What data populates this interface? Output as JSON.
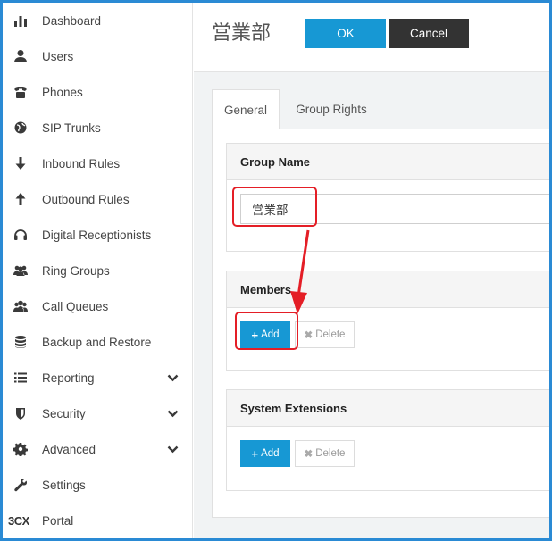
{
  "sidebar": {
    "items": [
      {
        "label": "Dashboard",
        "icon": "bar-chart-icon"
      },
      {
        "label": "Users",
        "icon": "user-icon"
      },
      {
        "label": "Phones",
        "icon": "phone-icon"
      },
      {
        "label": "SIP Trunks",
        "icon": "globe-icon"
      },
      {
        "label": "Inbound Rules",
        "icon": "arrow-down-icon"
      },
      {
        "label": "Outbound Rules",
        "icon": "arrow-up-icon"
      },
      {
        "label": "Digital Receptionists",
        "icon": "headset-icon"
      },
      {
        "label": "Ring Groups",
        "icon": "users-icon"
      },
      {
        "label": "Call Queues",
        "icon": "group-icon"
      },
      {
        "label": "Backup and Restore",
        "icon": "database-icon"
      },
      {
        "label": "Reporting",
        "icon": "list-icon"
      },
      {
        "label": "Security",
        "icon": "shield-icon"
      },
      {
        "label": "Advanced",
        "icon": "gear-icon"
      },
      {
        "label": "Settings",
        "icon": "wrench-icon"
      },
      {
        "label": "Portal",
        "logo": "3CX"
      }
    ]
  },
  "header": {
    "title": "営業部",
    "ok_label": "OK",
    "cancel_label": "Cancel"
  },
  "tabs": [
    {
      "label": "General",
      "active": true
    },
    {
      "label": "Group Rights",
      "active": false
    }
  ],
  "group_name": {
    "heading": "Group Name",
    "value": "営業部"
  },
  "members": {
    "heading": "Members",
    "add_label": "Add",
    "delete_label": "Delete"
  },
  "system_extensions": {
    "heading": "System Extensions",
    "add_label": "Add",
    "delete_label": "Delete"
  },
  "colors": {
    "accent": "#1798d4",
    "dark_button": "#333333",
    "highlight": "#e41e26",
    "frame": "#2a8ad4"
  }
}
